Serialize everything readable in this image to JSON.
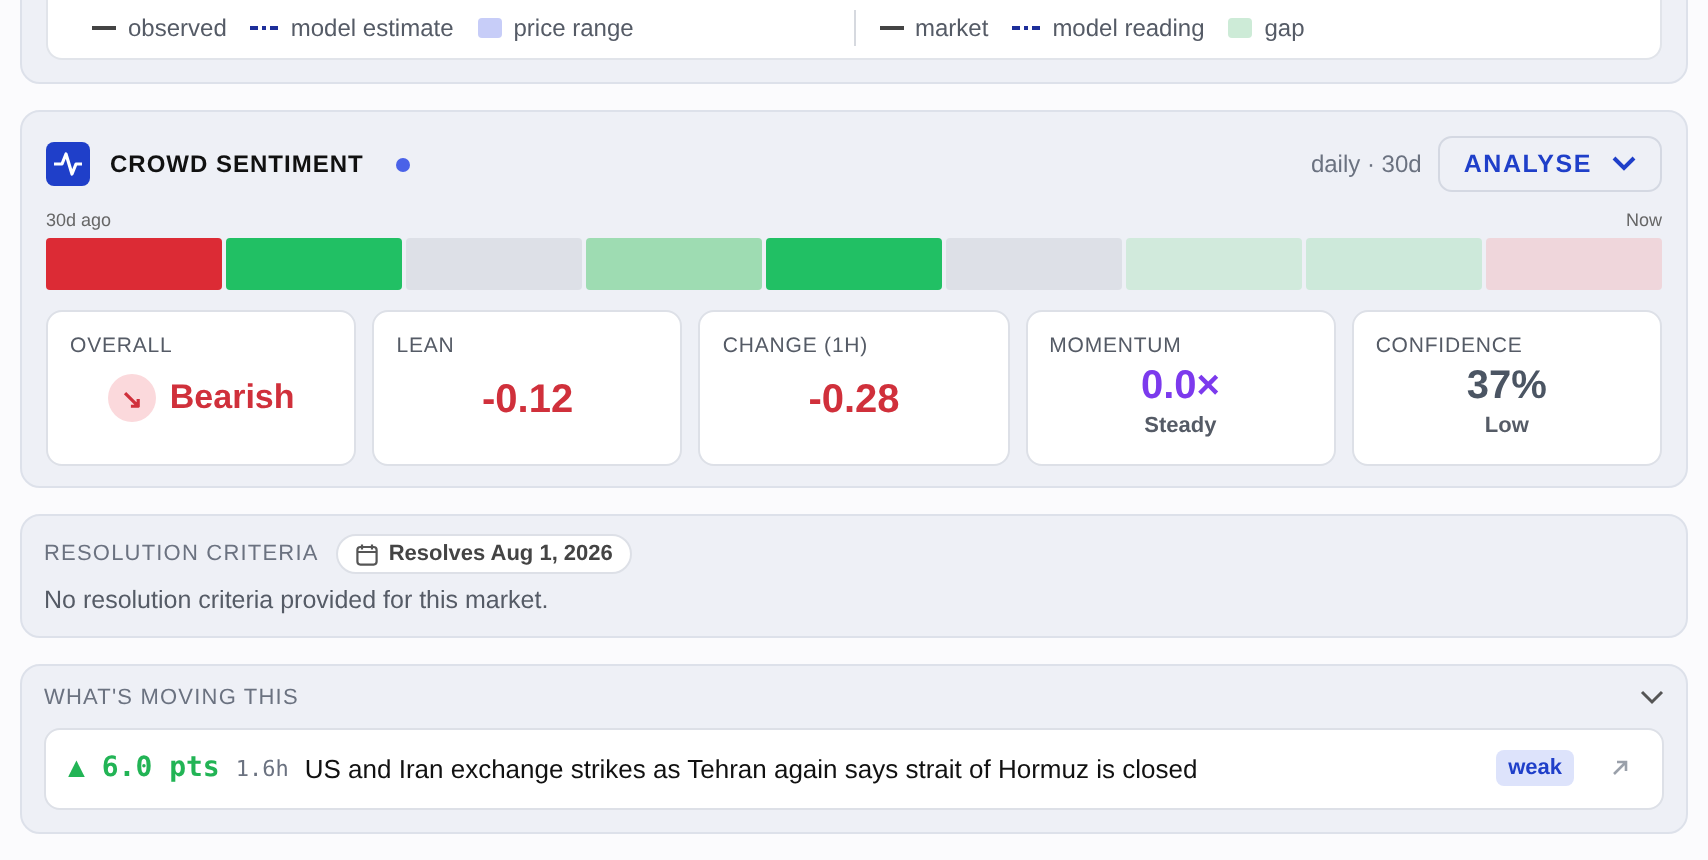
{
  "legend_left": [
    {
      "kind": "solid",
      "label": "observed"
    },
    {
      "kind": "dashed",
      "label": "model estimate"
    },
    {
      "kind": "swatch",
      "label": "price range",
      "color": "#c7cdf8"
    }
  ],
  "legend_right": [
    {
      "kind": "solid",
      "label": "market"
    },
    {
      "kind": "dashed",
      "label": "model reading"
    },
    {
      "kind": "swatch",
      "label": "gap",
      "color": "#cdebd7"
    }
  ],
  "sentiment": {
    "title": "CROWD SENTIMENT",
    "live": true,
    "period": "daily · 30d",
    "button": "ANALYSE",
    "start_label": "30d ago",
    "end_label": "Now",
    "heatmap": [
      {
        "color": "#dc2b35"
      },
      {
        "color": "#21c064"
      },
      {
        "color": "#dde0e7"
      },
      {
        "color": "#9edcb2"
      },
      {
        "color": "#21c064"
      },
      {
        "color": "#dde0e7"
      },
      {
        "color": "#d1eadc"
      },
      {
        "color": "#cde9da"
      },
      {
        "color": "#efd6db"
      }
    ],
    "stats": [
      {
        "kind": "trend",
        "label": "OVERALL",
        "value": "Bearish",
        "icon": "↘"
      },
      {
        "kind": "number",
        "label": "LEAN",
        "value": "-0.12",
        "color": "#d0303b"
      },
      {
        "kind": "number",
        "label": "CHANGE (1H)",
        "value": "-0.28",
        "color": "#d0303b"
      },
      {
        "kind": "sub",
        "label": "MOMENTUM",
        "value": "0.0×",
        "sub": "Steady",
        "color": "#7c3aed"
      },
      {
        "kind": "sub",
        "label": "CONFIDENCE",
        "value": "37%",
        "sub": "Low",
        "color": "#4b5563"
      }
    ]
  },
  "resolution": {
    "title": "RESOLUTION CRITERIA",
    "badge": "Resolves Aug 1, 2026",
    "text": "No resolution criteria provided for this market."
  },
  "moving": {
    "title": "WHAT'S MOVING THIS",
    "expanded": true,
    "items": [
      {
        "arrow": "▲",
        "points": "6.0 pts",
        "age": "1.6h",
        "headline": "US and Iran exchange strikes as Tehran again says strait of Hormuz is closed",
        "strength": "weak"
      }
    ]
  }
}
